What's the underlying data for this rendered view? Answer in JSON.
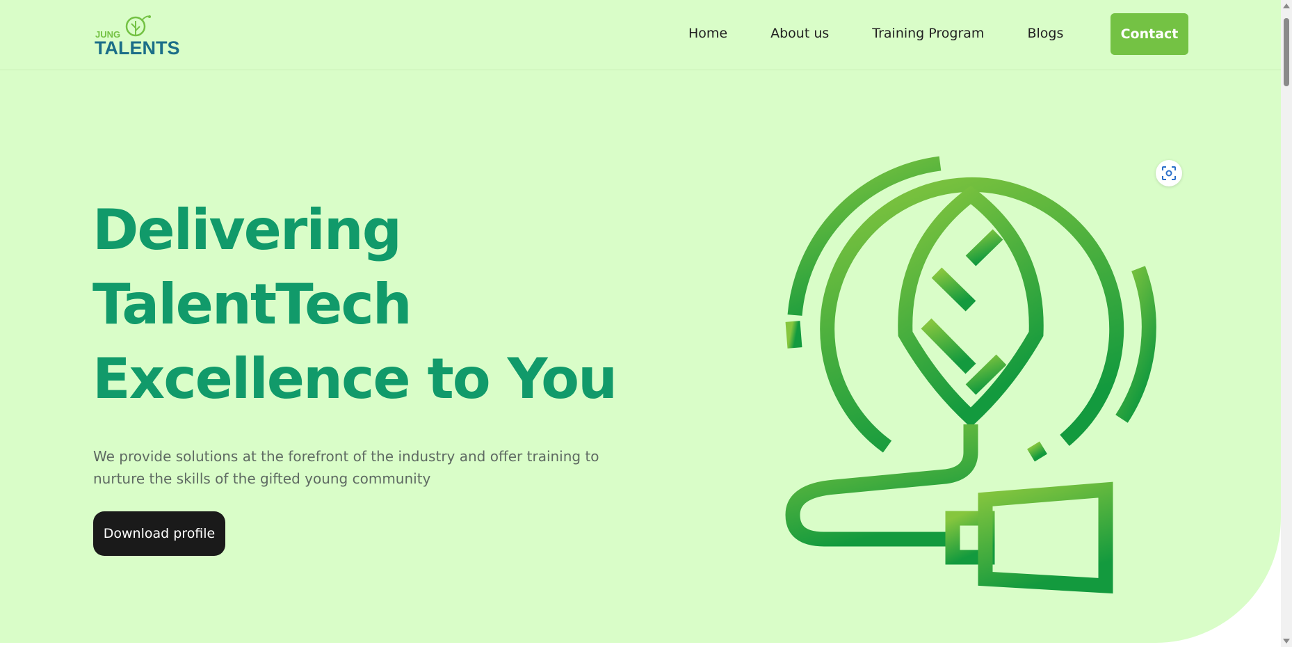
{
  "header": {
    "logo": {
      "small_text": "JUNG",
      "main_text": "TALENTS",
      "icon": "leaf-circle-icon"
    },
    "nav": [
      {
        "label": "Home"
      },
      {
        "label": "About us"
      },
      {
        "label": "Training Program"
      },
      {
        "label": "Blogs"
      }
    ],
    "contact_label": "Contact"
  },
  "hero": {
    "headline_lines": [
      "Delivering",
      "TalentTech",
      "Excellence to You"
    ],
    "subtext": "We provide solutions at the forefront of the industry and offer training to nurture the skills of the gifted young community",
    "cta_label": "Download profile",
    "illustration_icon": "leaf-plug-icon",
    "lens_icon": "visual-search-icon"
  },
  "colors": {
    "background": "#d9fdc8",
    "headline": "#119a6a",
    "accent_green": "#74c244",
    "cta_dark": "#1a1a1a"
  }
}
